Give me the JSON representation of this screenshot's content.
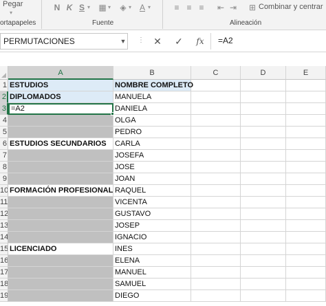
{
  "ribbon": {
    "paste_label": "Pegar",
    "clipboard_label": "ortapapeles",
    "font_label": "Fuente",
    "alignment_label": "Alineación",
    "merge_label": "Combinar y centrar",
    "bold_glyph": "N",
    "italic_glyph": "K",
    "underline_glyph": "S"
  },
  "formula_bar": {
    "name_box": "PERMUTACIONES",
    "formula": "=A2",
    "fx_label": "fx"
  },
  "columns": [
    "A",
    "B",
    "C",
    "D",
    "E"
  ],
  "rows": [
    {
      "num": "1",
      "a": "ESTUDIOS",
      "b": "NOMBRE COMPLETO"
    },
    {
      "num": "2",
      "a": "DIPLOMADOS",
      "b": "MANUELA"
    },
    {
      "num": "3",
      "a": "=A2",
      "b": "DANIELA"
    },
    {
      "num": "4",
      "a": "",
      "b": "OLGA"
    },
    {
      "num": "5",
      "a": "",
      "b": "PEDRO"
    },
    {
      "num": "6",
      "a": "ESTUDIOS SECUNDARIOS",
      "b": "CARLA"
    },
    {
      "num": "7",
      "a": "",
      "b": "JOSEFA"
    },
    {
      "num": "8",
      "a": "",
      "b": "JOSE"
    },
    {
      "num": "9",
      "a": "",
      "b": "JOAN"
    },
    {
      "num": "10",
      "a": "FORMACIÓN PROFESIONAL",
      "b": "RAQUEL"
    },
    {
      "num": "11",
      "a": "",
      "b": "VICENTA"
    },
    {
      "num": "12",
      "a": "",
      "b": "GUSTAVO"
    },
    {
      "num": "13",
      "a": "",
      "b": "JOSEP"
    },
    {
      "num": "14",
      "a": "",
      "b": "IGNACIO"
    },
    {
      "num": "15",
      "a": "LICENCIADO",
      "b": "INES"
    },
    {
      "num": "16",
      "a": "",
      "b": "ELENA"
    },
    {
      "num": "17",
      "a": "",
      "b": "MANUEL"
    },
    {
      "num": "18",
      "a": "",
      "b": "SAMUEL"
    },
    {
      "num": "19",
      "a": "",
      "b": "DIEGO"
    }
  ],
  "colors": {
    "accent": "#217346",
    "header_fill": "#ddebf7",
    "gray_fill": "#c0c0c0"
  }
}
